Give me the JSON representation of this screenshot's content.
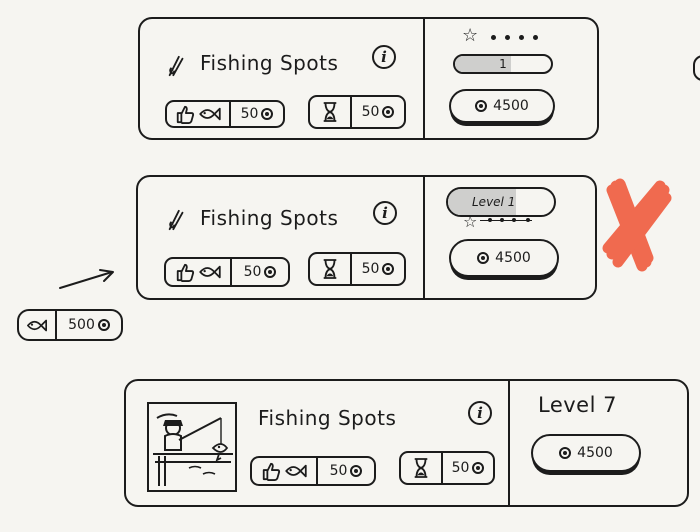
{
  "accent_color": "#f06a4f",
  "card1": {
    "title": "Fishing Spots",
    "rod_icon": "fishing-rod-icon",
    "like_stat": {
      "value": "50"
    },
    "time_stat": {
      "value": "50"
    },
    "level_value": "1",
    "stars_filled": 1,
    "stars_total": 5,
    "cost": "4500"
  },
  "card2": {
    "title": "Fishing Spots",
    "level_label": "Level 1",
    "like_stat": {
      "value": "50"
    },
    "time_stat": {
      "value": "50"
    },
    "cost": "4500"
  },
  "side_pill": {
    "value": "500"
  },
  "card3": {
    "title": "Fishing Spots",
    "level_label": "Level 7",
    "like_stat": {
      "value": "50"
    },
    "time_stat": {
      "value": "50"
    },
    "cost": "4500"
  }
}
